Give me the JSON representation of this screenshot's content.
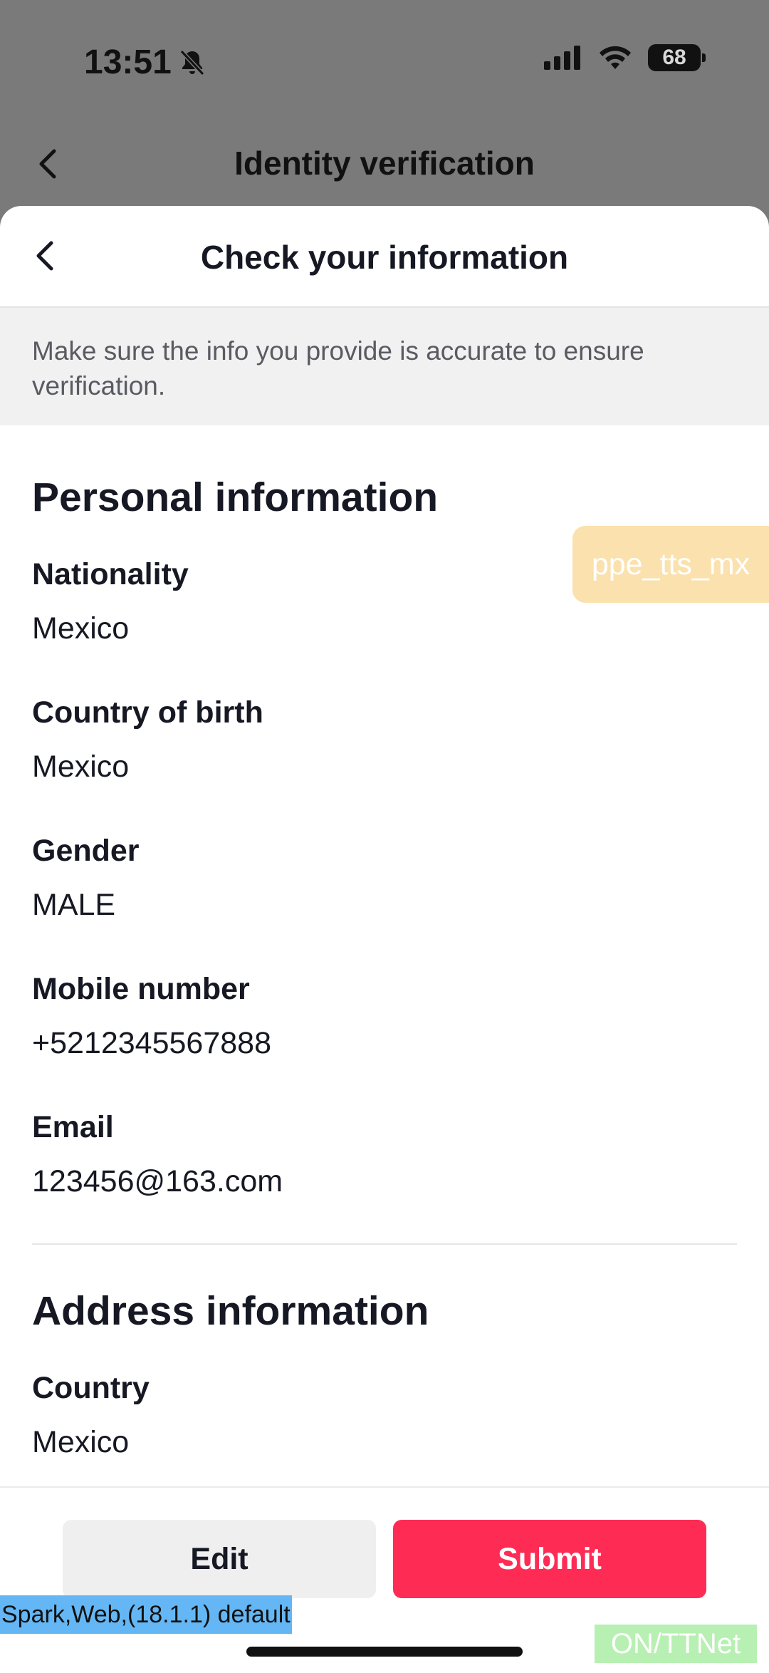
{
  "status_bar": {
    "time": "13:51",
    "battery": "68"
  },
  "background_screen": {
    "title": "Identity verification"
  },
  "sheet": {
    "title": "Check your information",
    "notice": "Make sure the info you provide is accurate to ensure verification."
  },
  "personal": {
    "title": "Personal information",
    "fields": [
      {
        "label": "Nationality",
        "value": "Mexico"
      },
      {
        "label": "Country of birth",
        "value": "Mexico"
      },
      {
        "label": "Gender",
        "value": "MALE"
      },
      {
        "label": "Mobile number",
        "value": "+5212345567888"
      },
      {
        "label": "Email",
        "value": "123456@163.com"
      }
    ]
  },
  "address": {
    "title": "Address information",
    "fields": [
      {
        "label": "Country",
        "value": "Mexico"
      }
    ]
  },
  "env_tag": "ppe_tts_mx",
  "buttons": {
    "edit": "Edit",
    "submit": "Submit"
  },
  "debug": {
    "build": "Spark,Web,(18.1.1) default",
    "network": "ON/TTNet"
  },
  "colors": {
    "accent": "#fe2c55",
    "overlay": "#7a7a7a"
  }
}
